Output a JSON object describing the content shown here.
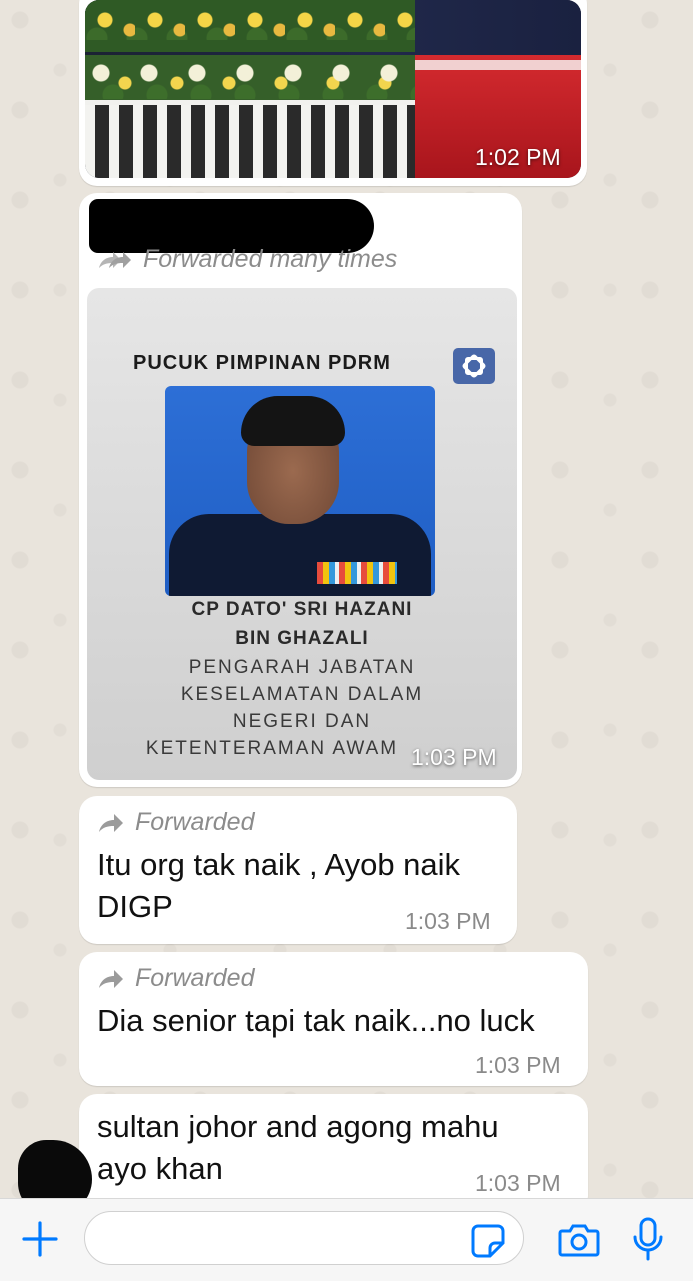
{
  "messages": [
    {
      "kind": "image",
      "time": "1:02 PM"
    },
    {
      "kind": "forwarded-image",
      "forward_label": "Forwarded many times",
      "time": "1:03 PM",
      "poster": {
        "title": "PUCUK PIMPINAN PDRM",
        "lines": [
          "CP DATO' SRI HAZANI",
          "BIN GHAZALI",
          "PENGARAH JABATAN",
          "KESELAMATAN DALAM",
          "NEGERI DAN",
          "KETENTERAMAN AWAM"
        ]
      }
    },
    {
      "kind": "text",
      "forward_label": "Forwarded",
      "text_line1": "Itu org tak naik , Ayob naik",
      "text_line2": "DIGP",
      "time": "1:03 PM"
    },
    {
      "kind": "text",
      "forward_label": "Forwarded",
      "text_line1": "Dia senior tapi tak naik...no luck",
      "time": "1:03 PM"
    },
    {
      "kind": "text",
      "text_line1": "sultan johor and agong mahu",
      "text_line2": "ayo khan",
      "time": "1:03 PM"
    }
  ],
  "composer": {
    "icons": [
      "plus-icon",
      "sticker-icon",
      "camera-icon",
      "microphone-icon"
    ],
    "accent_color": "#007aff"
  }
}
